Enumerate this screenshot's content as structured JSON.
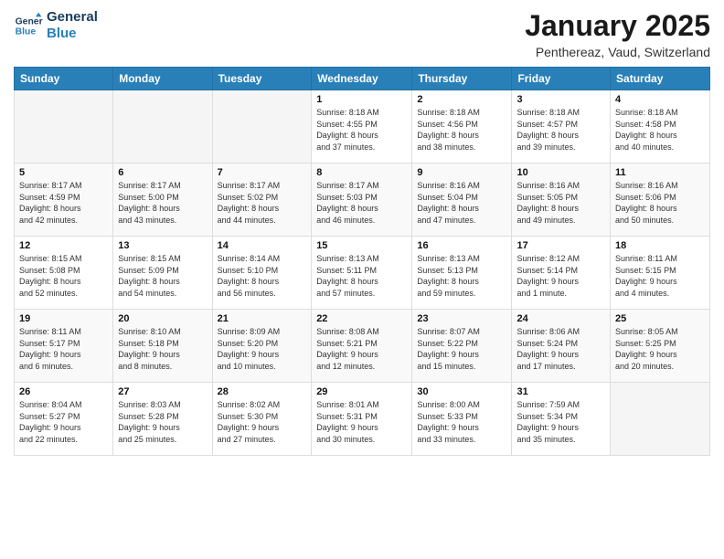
{
  "header": {
    "logo_line1": "General",
    "logo_line2": "Blue",
    "month_title": "January 2025",
    "location": "Penthereaz, Vaud, Switzerland"
  },
  "days_of_week": [
    "Sunday",
    "Monday",
    "Tuesday",
    "Wednesday",
    "Thursday",
    "Friday",
    "Saturday"
  ],
  "weeks": [
    [
      {
        "num": "",
        "info": ""
      },
      {
        "num": "",
        "info": ""
      },
      {
        "num": "",
        "info": ""
      },
      {
        "num": "1",
        "info": "Sunrise: 8:18 AM\nSunset: 4:55 PM\nDaylight: 8 hours\nand 37 minutes."
      },
      {
        "num": "2",
        "info": "Sunrise: 8:18 AM\nSunset: 4:56 PM\nDaylight: 8 hours\nand 38 minutes."
      },
      {
        "num": "3",
        "info": "Sunrise: 8:18 AM\nSunset: 4:57 PM\nDaylight: 8 hours\nand 39 minutes."
      },
      {
        "num": "4",
        "info": "Sunrise: 8:18 AM\nSunset: 4:58 PM\nDaylight: 8 hours\nand 40 minutes."
      }
    ],
    [
      {
        "num": "5",
        "info": "Sunrise: 8:17 AM\nSunset: 4:59 PM\nDaylight: 8 hours\nand 42 minutes."
      },
      {
        "num": "6",
        "info": "Sunrise: 8:17 AM\nSunset: 5:00 PM\nDaylight: 8 hours\nand 43 minutes."
      },
      {
        "num": "7",
        "info": "Sunrise: 8:17 AM\nSunset: 5:02 PM\nDaylight: 8 hours\nand 44 minutes."
      },
      {
        "num": "8",
        "info": "Sunrise: 8:17 AM\nSunset: 5:03 PM\nDaylight: 8 hours\nand 46 minutes."
      },
      {
        "num": "9",
        "info": "Sunrise: 8:16 AM\nSunset: 5:04 PM\nDaylight: 8 hours\nand 47 minutes."
      },
      {
        "num": "10",
        "info": "Sunrise: 8:16 AM\nSunset: 5:05 PM\nDaylight: 8 hours\nand 49 minutes."
      },
      {
        "num": "11",
        "info": "Sunrise: 8:16 AM\nSunset: 5:06 PM\nDaylight: 8 hours\nand 50 minutes."
      }
    ],
    [
      {
        "num": "12",
        "info": "Sunrise: 8:15 AM\nSunset: 5:08 PM\nDaylight: 8 hours\nand 52 minutes."
      },
      {
        "num": "13",
        "info": "Sunrise: 8:15 AM\nSunset: 5:09 PM\nDaylight: 8 hours\nand 54 minutes."
      },
      {
        "num": "14",
        "info": "Sunrise: 8:14 AM\nSunset: 5:10 PM\nDaylight: 8 hours\nand 56 minutes."
      },
      {
        "num": "15",
        "info": "Sunrise: 8:13 AM\nSunset: 5:11 PM\nDaylight: 8 hours\nand 57 minutes."
      },
      {
        "num": "16",
        "info": "Sunrise: 8:13 AM\nSunset: 5:13 PM\nDaylight: 8 hours\nand 59 minutes."
      },
      {
        "num": "17",
        "info": "Sunrise: 8:12 AM\nSunset: 5:14 PM\nDaylight: 9 hours\nand 1 minute."
      },
      {
        "num": "18",
        "info": "Sunrise: 8:11 AM\nSunset: 5:15 PM\nDaylight: 9 hours\nand 4 minutes."
      }
    ],
    [
      {
        "num": "19",
        "info": "Sunrise: 8:11 AM\nSunset: 5:17 PM\nDaylight: 9 hours\nand 6 minutes."
      },
      {
        "num": "20",
        "info": "Sunrise: 8:10 AM\nSunset: 5:18 PM\nDaylight: 9 hours\nand 8 minutes."
      },
      {
        "num": "21",
        "info": "Sunrise: 8:09 AM\nSunset: 5:20 PM\nDaylight: 9 hours\nand 10 minutes."
      },
      {
        "num": "22",
        "info": "Sunrise: 8:08 AM\nSunset: 5:21 PM\nDaylight: 9 hours\nand 12 minutes."
      },
      {
        "num": "23",
        "info": "Sunrise: 8:07 AM\nSunset: 5:22 PM\nDaylight: 9 hours\nand 15 minutes."
      },
      {
        "num": "24",
        "info": "Sunrise: 8:06 AM\nSunset: 5:24 PM\nDaylight: 9 hours\nand 17 minutes."
      },
      {
        "num": "25",
        "info": "Sunrise: 8:05 AM\nSunset: 5:25 PM\nDaylight: 9 hours\nand 20 minutes."
      }
    ],
    [
      {
        "num": "26",
        "info": "Sunrise: 8:04 AM\nSunset: 5:27 PM\nDaylight: 9 hours\nand 22 minutes."
      },
      {
        "num": "27",
        "info": "Sunrise: 8:03 AM\nSunset: 5:28 PM\nDaylight: 9 hours\nand 25 minutes."
      },
      {
        "num": "28",
        "info": "Sunrise: 8:02 AM\nSunset: 5:30 PM\nDaylight: 9 hours\nand 27 minutes."
      },
      {
        "num": "29",
        "info": "Sunrise: 8:01 AM\nSunset: 5:31 PM\nDaylight: 9 hours\nand 30 minutes."
      },
      {
        "num": "30",
        "info": "Sunrise: 8:00 AM\nSunset: 5:33 PM\nDaylight: 9 hours\nand 33 minutes."
      },
      {
        "num": "31",
        "info": "Sunrise: 7:59 AM\nSunset: 5:34 PM\nDaylight: 9 hours\nand 35 minutes."
      },
      {
        "num": "",
        "info": ""
      }
    ]
  ]
}
